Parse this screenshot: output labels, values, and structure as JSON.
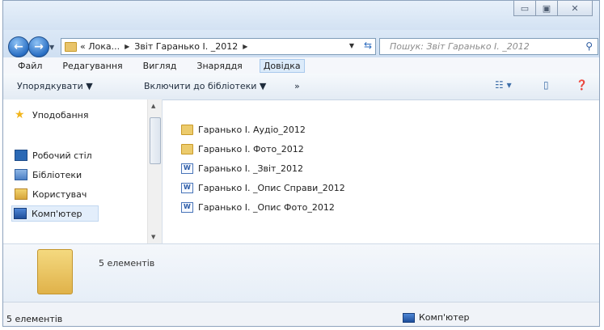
{
  "address": {
    "crumbs": [
      "« Лока...",
      "Звіт Гаранько І. _2012"
    ]
  },
  "search": {
    "placeholder": "Пошук: Звіт Гаранько І. _2012"
  },
  "menu": [
    "Файл",
    "Редагування",
    "Вигляд",
    "Знаряддя",
    "Довідка"
  ],
  "toolbar": {
    "organize": "Упорядкувати ▼",
    "include": "Включити до бібліотеки ▼",
    "more": "»"
  },
  "nav": {
    "favorites": "Уподобання",
    "desktop": "Робочий стіл",
    "libraries": "Бібліотеки",
    "user": "Користувач",
    "computer": "Комп'ютер"
  },
  "files": [
    {
      "name": "Гаранько І. Аудіо_2012",
      "type": "folder"
    },
    {
      "name": "Гаранько І. Фото_2012",
      "type": "folder"
    },
    {
      "name": "Гаранько І. _Звіт_2012",
      "type": "doc"
    },
    {
      "name": "Гаранько І. _Опис Справи_2012",
      "type": "doc"
    },
    {
      "name": "Гаранько І. _Опис Фото_2012",
      "type": "doc"
    }
  ],
  "details": {
    "count": "5 елементів"
  },
  "status": {
    "left": "5 елементів",
    "right": "Комп'ютер"
  }
}
